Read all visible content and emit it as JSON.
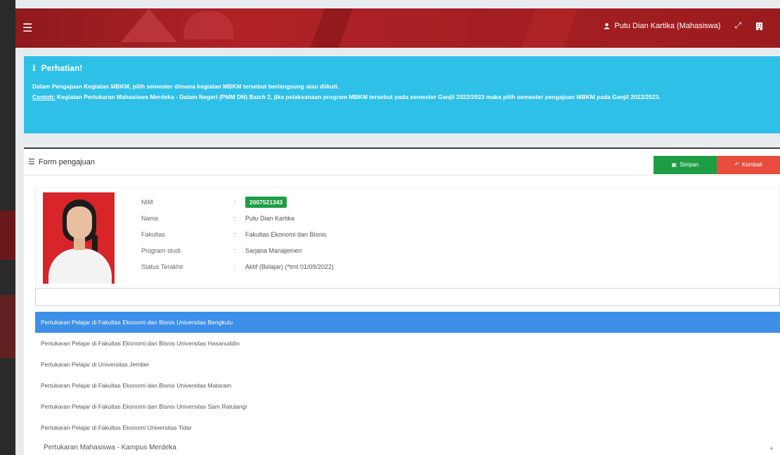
{
  "topbar": {
    "user_name": "Putu Dian Kartika (Mahasiswa)"
  },
  "alert": {
    "title": "Perhatian!",
    "line1": "Dalam Pengajuan Kegiatan MBKM, pilih semester dimana kegiatan MBKM tersebut berlangsung atau diikuti.",
    "example_label": "Contoh:",
    "line2": "Kegiatan Pertukaran Mahasiswa Merdeka - Dalam Negeri (PMM DN) Batch 2, jika pelaksanaan program MBKM tersebut pada semester Ganjil 2022/2023 maka pilih semester pengajuan MBKM pada Ganjil 2022/2023."
  },
  "form": {
    "title": "Form pengajuan",
    "save_label": "Simpan",
    "back_label": "Kembali"
  },
  "profile": {
    "nim_label": "NIM",
    "nim_value": "2007521343",
    "nama_label": "Nama",
    "nama_value": "Putu Dian Kartika",
    "fakultas_label": "Fakultas",
    "fakultas_value": "Fakultas Ekonomi dan Bisnis",
    "prodi_label": "Program studi",
    "prodi_value": "Sarjana Manajemen",
    "status_label": "Status Terakhir",
    "status_value": "Aktif (Belajar) (*tmt 01/09/2022)"
  },
  "search": {
    "value": ""
  },
  "dropdown": {
    "options": [
      "Pertukaran Pelajar di Fakultas Ekonomi dan Bisnis Universitas Bengkulu",
      "Pertukaran Pelajar di Fakultas Ekonomi dan Bisnis Universitas Hasanuddin",
      "Pertukaran Pelajar di Universitas Jember",
      "Pertukaran Pelajar di Fakultas Ekonomi dan Bisnis Universitas Mataram",
      "Pertukaran Pelajar di Fakultas Ekonomi dan Bisnis Universitas Sam Ratulangi",
      "Pertukaran Pelajar di Fakultas Ekonomi Universitas Tidar"
    ]
  },
  "program_select": {
    "value": "Pertukaran Mahasiswa - Kampus Merdeka"
  },
  "colors": {
    "topbar": "#a51f22",
    "alert": "#2fc0e8",
    "save": "#1f9d45",
    "back": "#e74c3c",
    "highlight": "#3d8fe7"
  },
  "icons": {
    "menu": "hamburger-icon",
    "user": "user-icon",
    "expand": "expand-icon",
    "building": "building-icon",
    "info": "info-icon",
    "list": "list-icon",
    "save": "save-icon",
    "back": "reply-icon",
    "chevron": "chevron-up-icon"
  }
}
